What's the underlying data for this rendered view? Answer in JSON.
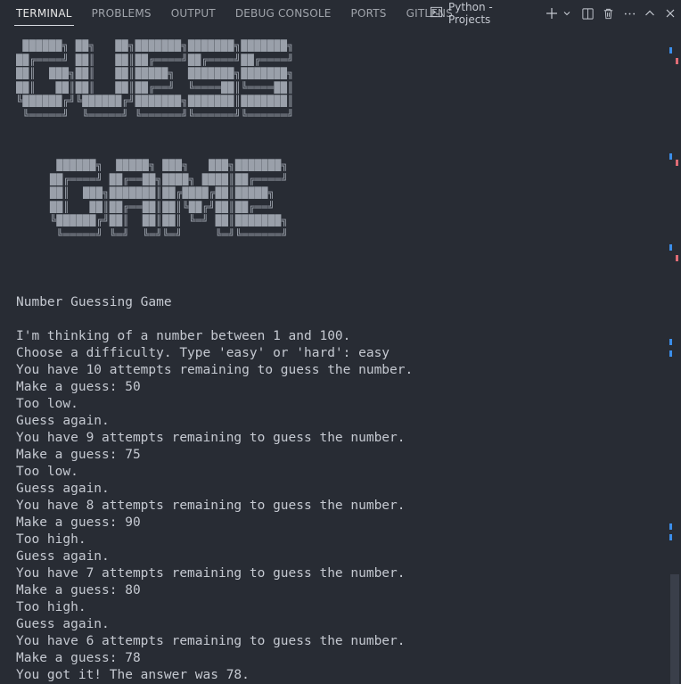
{
  "tabs": [
    {
      "label": "TERMINAL",
      "active": true
    },
    {
      "label": "PROBLEMS",
      "active": false
    },
    {
      "label": "OUTPUT",
      "active": false
    },
    {
      "label": "DEBUG CONSOLE",
      "active": false
    },
    {
      "label": "PORTS",
      "active": false
    },
    {
      "label": "GITLENS",
      "active": false
    }
  ],
  "toolbar": {
    "terminal_name": "Python - Projects",
    "icons": [
      "terminal-icon",
      "plus-icon",
      "chevron-down-icon",
      "split-icon",
      "trash-icon",
      "more-icon",
      "chevron-up-icon",
      "close-icon"
    ]
  },
  "banner": {
    "line1": "GUESS",
    "line2": "GAME"
  },
  "terminal_lines": [
    "Number Guessing Game",
    "",
    "I'm thinking of a number between 1 and 100.",
    "Choose a difficulty. Type 'easy' or 'hard': easy",
    "You have 10 attempts remaining to guess the number.",
    "Make a guess: 50",
    "Too low.",
    "Guess again.",
    "You have 9 attempts remaining to guess the number.",
    "Make a guess: 75",
    "Too low.",
    "Guess again.",
    "You have 8 attempts remaining to guess the number.",
    "Make a guess: 90",
    "Too high.",
    "Guess again.",
    "You have 7 attempts remaining to guess the number.",
    "Make a guess: 80",
    "Too high.",
    "Guess again.",
    "You have 6 attempts remaining to guess the number.",
    "Make a guess: 78",
    "You got it! The answer was 78."
  ],
  "colors": {
    "background": "#282c34",
    "text": "#c5c9d1",
    "scroll_mark_blue": "#3b8eea",
    "scroll_mark_red": "#e06c75"
  }
}
